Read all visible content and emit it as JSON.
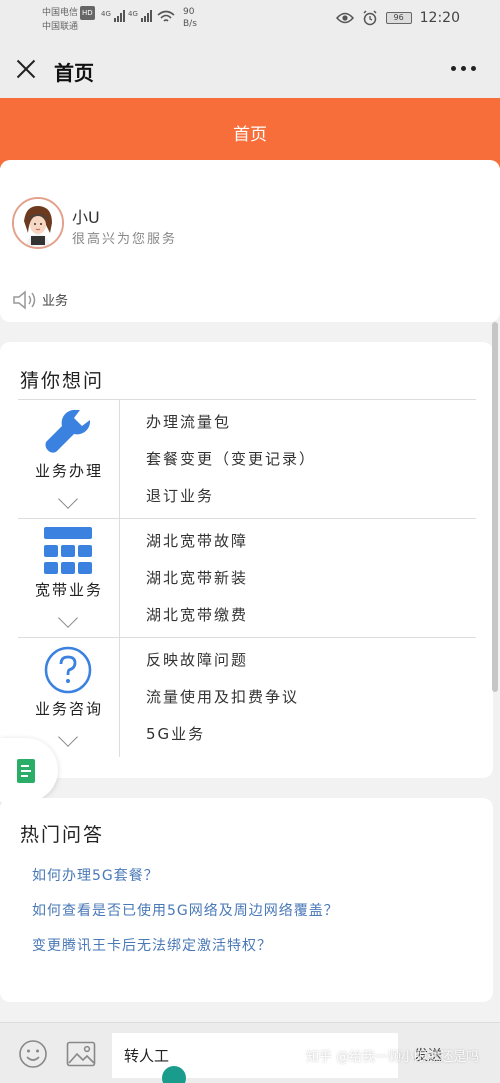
{
  "status_bar": {
    "carrier_1": "中国电信",
    "carrier_1_badge": "HD",
    "carrier_2": "中国联通",
    "network_1": "4G",
    "network_2": "4G",
    "speed_value": "90",
    "speed_unit": "B/s",
    "battery": "96",
    "time": "12:20"
  },
  "title_bar": {
    "title": "首页"
  },
  "header": {
    "title": "首页"
  },
  "intro": {
    "bot_name": "小U",
    "bot_subtitle": "很高兴为您服务",
    "notice": "业务"
  },
  "guess": {
    "title": "猜你想问",
    "categories": [
      {
        "label": "业务办理",
        "icon": "wrench-icon",
        "items": [
          "办理流量包",
          "套餐变更（变更记录）",
          "退订业务"
        ]
      },
      {
        "label": "宽带业务",
        "icon": "grid-icon",
        "items": [
          "湖北宽带故障",
          "湖北宽带新装",
          "湖北宽带缴费"
        ]
      },
      {
        "label": "业务咨询",
        "icon": "question-icon",
        "items": [
          "反映故障问题",
          "流量使用及扣费争议",
          "5G业务"
        ]
      }
    ]
  },
  "hot": {
    "title": "热门问答",
    "items": [
      "如何办理5G套餐？",
      "如何查看是否已使用5G网络及周边网络覆盖？",
      "变更腾讯王卡后无法绑定激活特权？"
    ]
  },
  "input_bar": {
    "value": "转人工",
    "send_label": "发送"
  },
  "watermark": "知乎 @给我一颗小眼就还是吗",
  "colors": {
    "accent": "#f86e3a",
    "link": "#4a79b8",
    "icon_blue": "#3b82e0"
  }
}
